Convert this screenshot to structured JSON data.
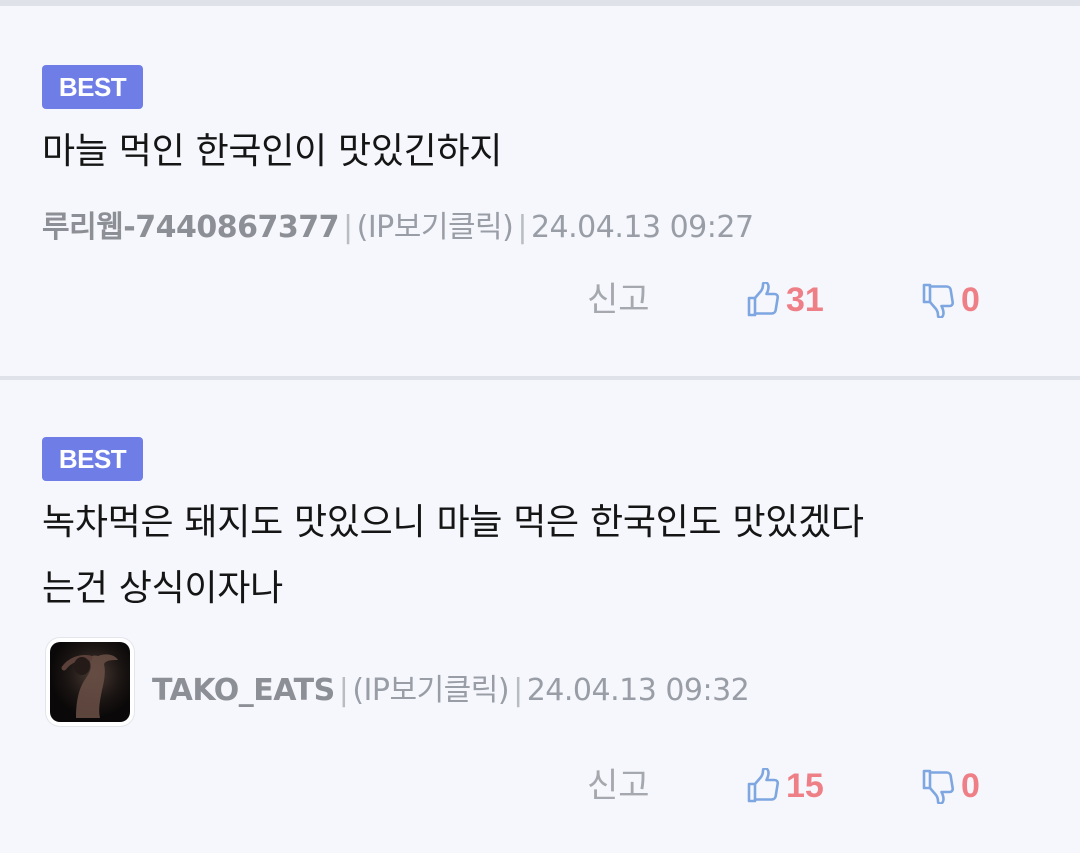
{
  "comments": [
    {
      "badge": "BEST",
      "text": "마늘 먹인 한국인이 맛있긴하지",
      "author": "루리웹-7440867377",
      "separator": "|",
      "ip_label": "(IP보기클릭)",
      "timestamp": "24.04.13 09:27",
      "report_label": "신고",
      "likes": "31",
      "dislikes": "0",
      "has_avatar": false
    },
    {
      "badge": "BEST",
      "text_line1": "녹차먹은 돼지도 맛있으니 마늘 먹은 한국인도 맛있겠다",
      "text_line2": "는건 상식이자나",
      "author": "TAKO_EATS",
      "separator": "|",
      "ip_label": "(IP보기클릭)",
      "timestamp": "24.04.13 09:32",
      "report_label": "신고",
      "likes": "15",
      "dislikes": "0",
      "has_avatar": true
    }
  ],
  "icons": {
    "like": "thumbs-up-icon",
    "dislike": "thumbs-down-icon"
  },
  "colors": {
    "badge_bg": "#6f7ee7",
    "count": "#ef7f86",
    "icon": "#7ea6e0",
    "background": "#f5f7fc"
  }
}
